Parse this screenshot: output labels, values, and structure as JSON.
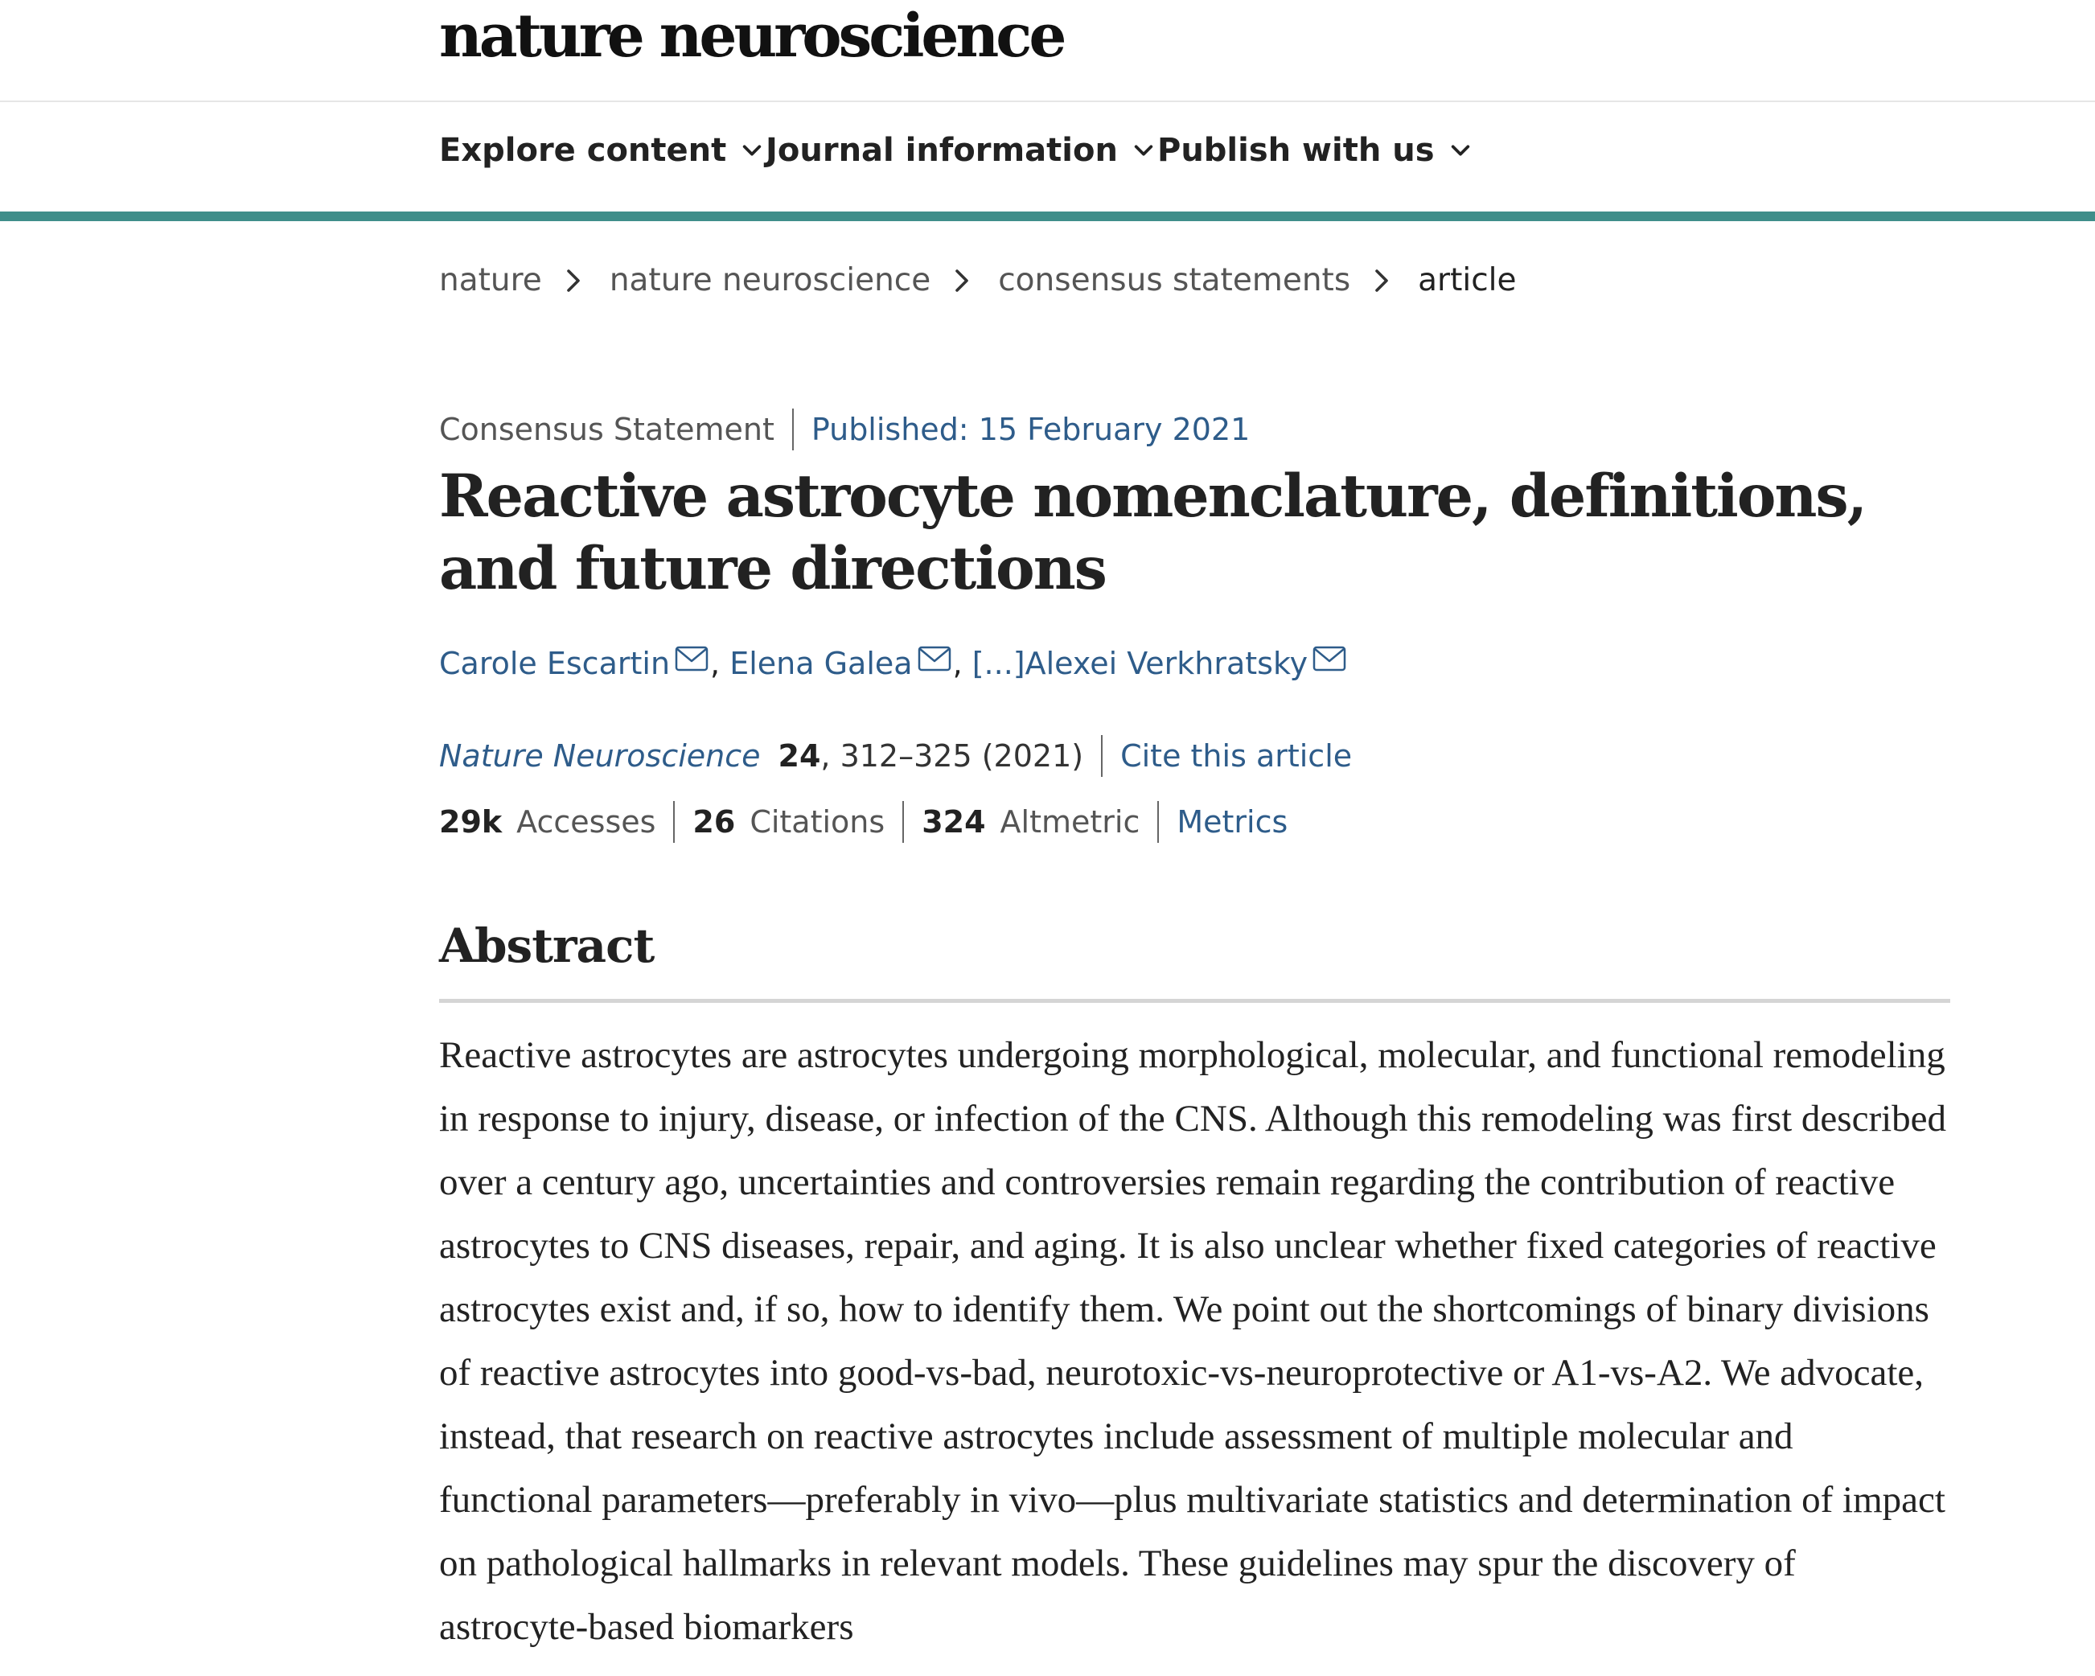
{
  "site": {
    "logo": "nature neuroscience"
  },
  "nav": {
    "items": [
      {
        "label": "Explore content"
      },
      {
        "label": "Journal information"
      },
      {
        "label": "Publish with us"
      }
    ]
  },
  "colors": {
    "accent_rule": "#3f8e8a",
    "link": "#2e5c8a"
  },
  "breadcrumb": [
    "nature",
    "nature neuroscience",
    "consensus statements",
    "article"
  ],
  "article": {
    "type": "Consensus Statement",
    "published": "Published: 15 February 2021",
    "title": "Reactive astrocyte nomenclature, definitions, and future directions",
    "authors": [
      "Carole Escartin",
      "Elena Galea",
      "[...]Alexei Verkhratsky"
    ],
    "journal": "Nature Neuroscience",
    "volume": "24",
    "pages_year": ", 312–325 (2021)",
    "cite_label": "Cite this article"
  },
  "metrics": {
    "accesses_value": "29k",
    "accesses_label": "Accesses",
    "citations_value": "26",
    "citations_label": "Citations",
    "altmetric_value": "324",
    "altmetric_label": "Altmetric",
    "metrics_link": "Metrics"
  },
  "abstract": {
    "heading": "Abstract",
    "text": "Reactive astrocytes are astrocytes undergoing morphological, molecular, and functional remodeling in response to injury, disease, or infection of the CNS. Although this remodeling was first described over a century ago, uncertainties and controversies remain regarding the contribution of reactive astrocytes to CNS diseases, repair, and aging. It is also unclear whether fixed categories of reactive astrocytes exist and, if so, how to identify them. We point out the shortcomings of binary divisions of reactive astrocytes into good-vs-bad, neurotoxic-vs-neuroprotective or A1-vs-A2. We advocate, instead, that research on reactive astrocytes include assessment of multiple molecular and functional parameters—preferably in vivo—plus multivariate statistics and determination of impact on pathological hallmarks in relevant models. These guidelines may spur the discovery of astrocyte-based biomarkers"
  }
}
